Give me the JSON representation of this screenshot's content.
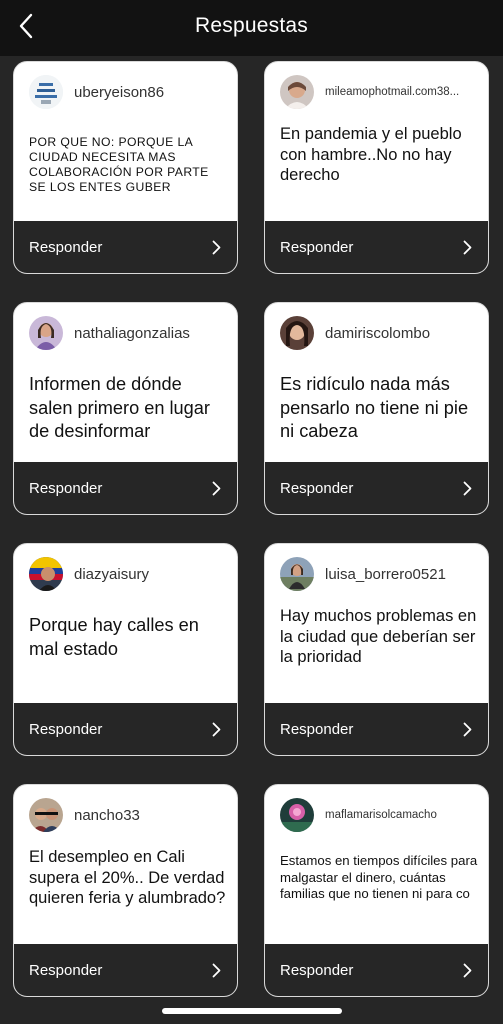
{
  "header": {
    "title": "Respuestas",
    "back_icon": "chevron-left-icon"
  },
  "colors": {
    "background": "#262626",
    "header": "#121212",
    "card": "#ffffff",
    "text": "#111111"
  },
  "cards": [
    {
      "username": "uberyeison86",
      "text": "POR QUE NO: PORQUE LA CIUDAD NECESITA MAS COLABORACIÓN POR PARTE SE LOS ENTES GUBER",
      "button": "Responder"
    },
    {
      "username": "mileamophotmail.com38...",
      "text": "En pandemia y el pueblo con hambre..No no hay derecho",
      "button": "Responder"
    },
    {
      "username": "nathaliagonzalias",
      "text": "Informen de dónde salen primero en lugar de desinformar",
      "button": "Responder"
    },
    {
      "username": "damiriscolombo",
      "text": "Es ridículo nada más pensarlo no tiene ni pie ni cabeza",
      "button": "Responder"
    },
    {
      "username": "diazyaisury",
      "text": "Porque hay calles en mal estado",
      "button": "Responder"
    },
    {
      "username": "luisa_borrero0521",
      "text": "Hay muchos problemas en la ciudad que deberían ser la prioridad",
      "button": "Responder"
    },
    {
      "username": "nancho33",
      "text": "El desempleo en Cali supera el 20%.. De verdad quieren feria y alumbrado?",
      "button": "Responder"
    },
    {
      "username": "maflamarisolcamacho",
      "text": "Estamos en tiempos difíciles  para malgastar el dinero, cuántas familias que no tienen ni para co",
      "button": "Responder"
    }
  ]
}
